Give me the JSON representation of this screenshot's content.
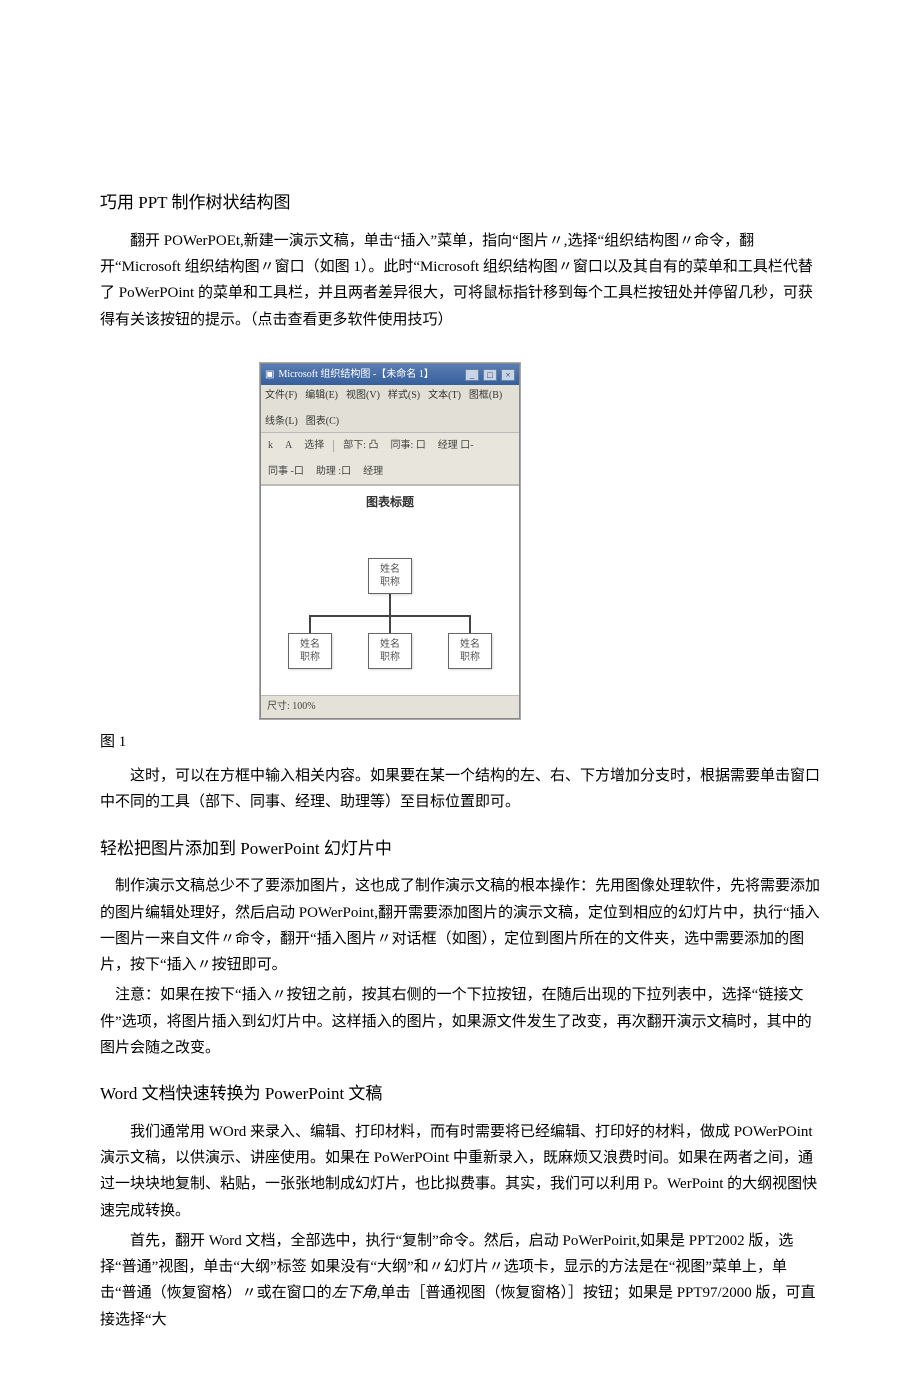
{
  "section1": {
    "title": "巧用 PPT 制作树状结构图",
    "body": "翻开 POWerPOEt,新建一演示文稿，单击“插入”菜单，指向“图片〃,选择“组织结构图〃命令，翻开“Microsoft 组织结构图〃窗口（如图 1）。此时“Microsoft 组织结构图〃窗口以及其自有的菜单和工具栏代替了 PoWerPOint 的菜单和工具栏，并且两者差异很大，可将鼠标指针移到每个工具栏按钮处并停留几秒，可获得有关该按钮的提示。（点击查看更多软件使用技巧）",
    "fig_caption": "图 1",
    "after_fig": "这时，可以在方框中输入相关内容。如果要在某一个结构的左、右、下方增加分支时，根据需要单击窗口中不同的工具（部下、同事、经理、助理等）至目标位置即可。"
  },
  "figure1": {
    "title": "Microsoft 组织结构图 -【未命名 1】",
    "menus": [
      "文件(F)",
      "编辑(E)",
      "视图(V)",
      "样式(S)",
      "文本(T)",
      "图框(B)",
      "线条(L)",
      "图表(C)"
    ],
    "tools": [
      "k",
      "A",
      "选择",
      "部下: 凸",
      "同事: 口",
      "经理 口-",
      "同事 -口",
      "助理 :口",
      "经理"
    ],
    "chart_title": "图表标题",
    "box_top": {
      "l1": "姓名",
      "l2": "职称"
    },
    "box_a": {
      "l1": "姓名",
      "l2": "职称"
    },
    "box_b": {
      "l1": "姓名",
      "l2": "职称"
    },
    "box_c": {
      "l1": "姓名",
      "l2": "职称"
    },
    "status": "尺寸: 100%"
  },
  "section2": {
    "title": "轻松把图片添加到 PowerPoint 幻灯片中",
    "p1": "制作演示文稿总少不了要添加图片，这也成了制作演示文稿的根本操作：先用图像处理软件，先将需要添加的图片编辑处理好，然后启动 POWerPoint,翻开需要添加图片的演示文稿，定位到相应的幻灯片中，执行“插入一图片一来自文件〃命令，翻开“插入图片〃对话框（如图），定位到图片所在的文件夹，选中需要添加的图片，按下“插入〃按钮即可。",
    "p2": "注意：如果在按下“插入〃按钮之前，按其右侧的一个下拉按钮，在随后出现的下拉列表中，选择“链接文件”选项，将图片插入到幻灯片中。这样插入的图片，如果源文件发生了改变，再次翻开演示文稿时，其中的图片会随之改变。"
  },
  "section3": {
    "title": "Word 文档快速转换为 PowerPoint 文稿",
    "p1": "我们通常用 WOrd 来录入、编辑、打印材料，而有时需要将已经编辑、打印好的材料，做成 POWerPOint 演示文稿，以供演示、讲座使用。如果在 PoWerPOint 中重新录入，既麻烦又浪费时间。如果在两者之间，通过一块块地复制、粘贴，一张张地制成幻灯片，也比拟费事。其实，我们可以利用 P。WerPoint 的大纲视图快速完成转换。",
    "p2_part1": "首先，翻开 Word 文档，全部选中，执行“复制”命令。然后，启动 PoWerPoirit,如果是 PPT2002 版，选择“普通”视图，单击“大纲”标签 如果没有“大纲”和〃幻灯片〃选项卡，显示的方法是在“视图”菜单上，单击“普通（恢复窗格）〃或在窗口的",
    "p2_italic": "左下角,",
    "p2_part2": "单击［普通视图（恢复窗格）］按钮；如果是 PPT97/2000 版，可直接选择“大"
  }
}
